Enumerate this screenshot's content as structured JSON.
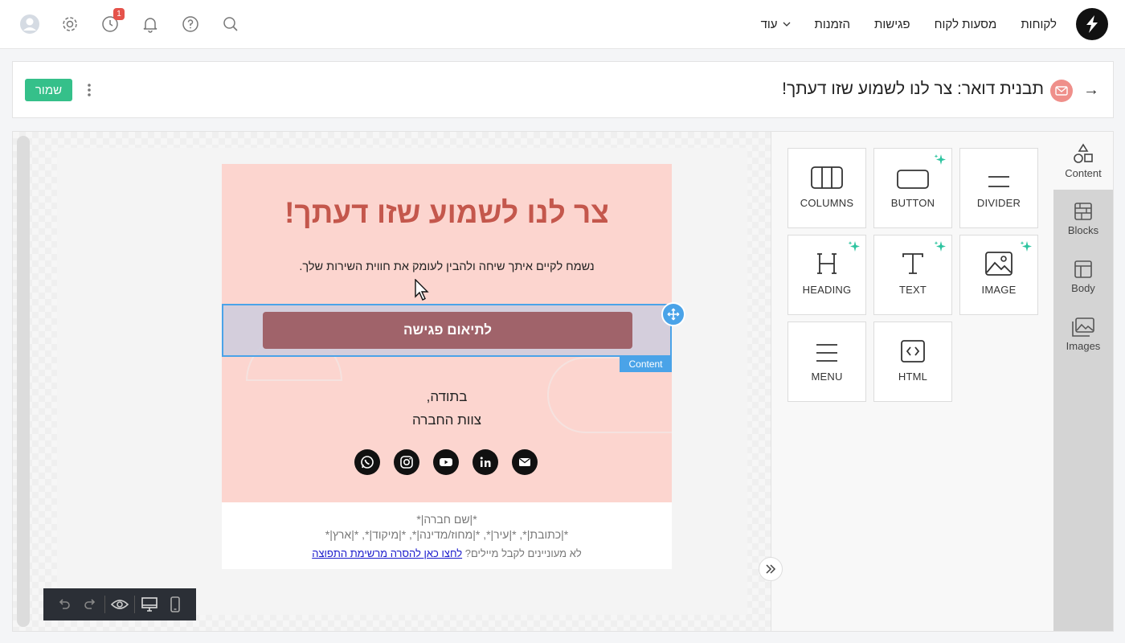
{
  "nav": {
    "items": [
      "לקוחות",
      "מסעות לקוח",
      "פגישות",
      "הזמנות"
    ],
    "more_label": "עוד",
    "history_badge": "1"
  },
  "header": {
    "title": "תבנית דואר: צר לנו לשמוע שזו דעתך!",
    "save_label": "שמור"
  },
  "email": {
    "heading": "צר לנו לשמוע שזו דעתך!",
    "text": "נשמח לקיים איתך שיחה ולהבין לעומק את חווית השירות שלך.",
    "cta_label": "לתיאום פגישה",
    "content_tag": "Content",
    "signoff_line1": "בתודה,",
    "signoff_line2": "צוות החברה",
    "footer_line1": "*|שם חברה|*",
    "footer_line2": "*|כתובת|*, *|עיר|*, *|מחוז/מדינה|*, *|מיקוד|*, *|ארץ|*",
    "footer_unsub_prefix": "לא מעוניינים לקבל מיילים?",
    "footer_unsub_link": "לחצו כאן להסרה מרשימת התפוצה"
  },
  "tools": [
    "COLUMNS",
    "BUTTON",
    "DIVIDER",
    "HEADING",
    "TEXT",
    "IMAGE",
    "MENU",
    "HTML"
  ],
  "side_tabs": [
    "Content",
    "Blocks",
    "Body",
    "Images"
  ],
  "colors": {
    "save": "#35c08a",
    "accent": "#4aa3e8",
    "email_bg": "#fcd5cf",
    "heading": "#c4574c",
    "cta": "#a0636a"
  }
}
